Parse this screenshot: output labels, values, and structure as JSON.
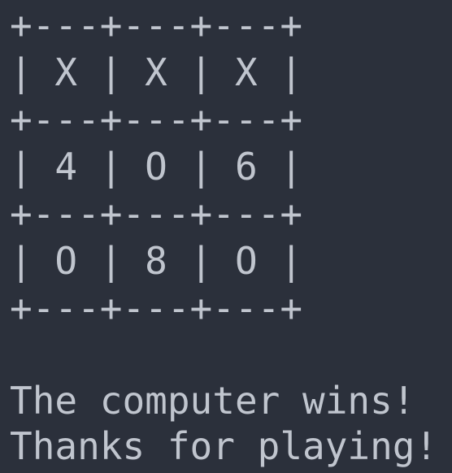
{
  "terminal": {
    "colors": {
      "background": "#2b303b",
      "foreground": "#c0c5ce"
    },
    "board_lines": [
      "+---+---+---+",
      "| X | X | X |",
      "+---+---+---+",
      "| 4 | O | 6 |",
      "+---+---+---+",
      "| O | 8 | O |",
      "+---+---+---+"
    ],
    "messages": [
      "The computer wins!",
      "Thanks for playing!"
    ]
  }
}
